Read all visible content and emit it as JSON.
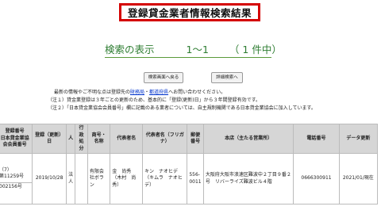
{
  "page_title": "登録貸金業者情報検索結果",
  "result": {
    "label": "検索の表示",
    "range": "1〜1",
    "count": "（ 1 件中）"
  },
  "buttons": {
    "back": "検索画面へ戻る",
    "detail": "詳細検索へ"
  },
  "notes": {
    "line1_prefix": "最新の情報やご不明な点は登録先の",
    "link_zaimukyoku": "財務局",
    "line1_sep": "・",
    "link_todofuken": "都道府県",
    "line1_suffix": "へお問い合わせください。",
    "line2": "（注１）貸金業登録は３年ごとの更新のため、基本的に「登録(更新)日」から３年間登録有効です。",
    "line3": "（注２）「日本貸金業協会会員番号」欄に記載のある業者については、自主規制機関である日本貸金業協会に加入しています。"
  },
  "table": {
    "headers": {
      "reg_no": "登録番号",
      "assoc_no": "日本貸金業協会会員番号",
      "reg_date": "登録（更新）日",
      "person_type": "人",
      "business": "行政処分",
      "trade_name": "商号・名称",
      "representative": "代表者名",
      "rep_kana": "代表者名（フリガナ）",
      "postal": "郵便番号",
      "office": "本店（主たる営業所）",
      "phone": "電話番号",
      "data_date": "データ更新"
    },
    "row": {
      "reg_no_a": "（7）",
      "reg_no_b": "第11259号",
      "assoc_no": "002156号",
      "reg_date": "2019/10/28",
      "person_type": "法人",
      "business": "",
      "trade_name": "有限会社ボラン",
      "representative": "金　尚秀（木村　尚秀）",
      "rep_kana": "キン　ナオヒデ（キムラ　ナオヒデ）",
      "postal": "556-0011",
      "office": "大阪府大阪市浪速区難波中２丁目９番２号　リバーライズ難波ビル４階",
      "phone": "0666300911",
      "data_date": "2021/01/現在"
    }
  }
}
